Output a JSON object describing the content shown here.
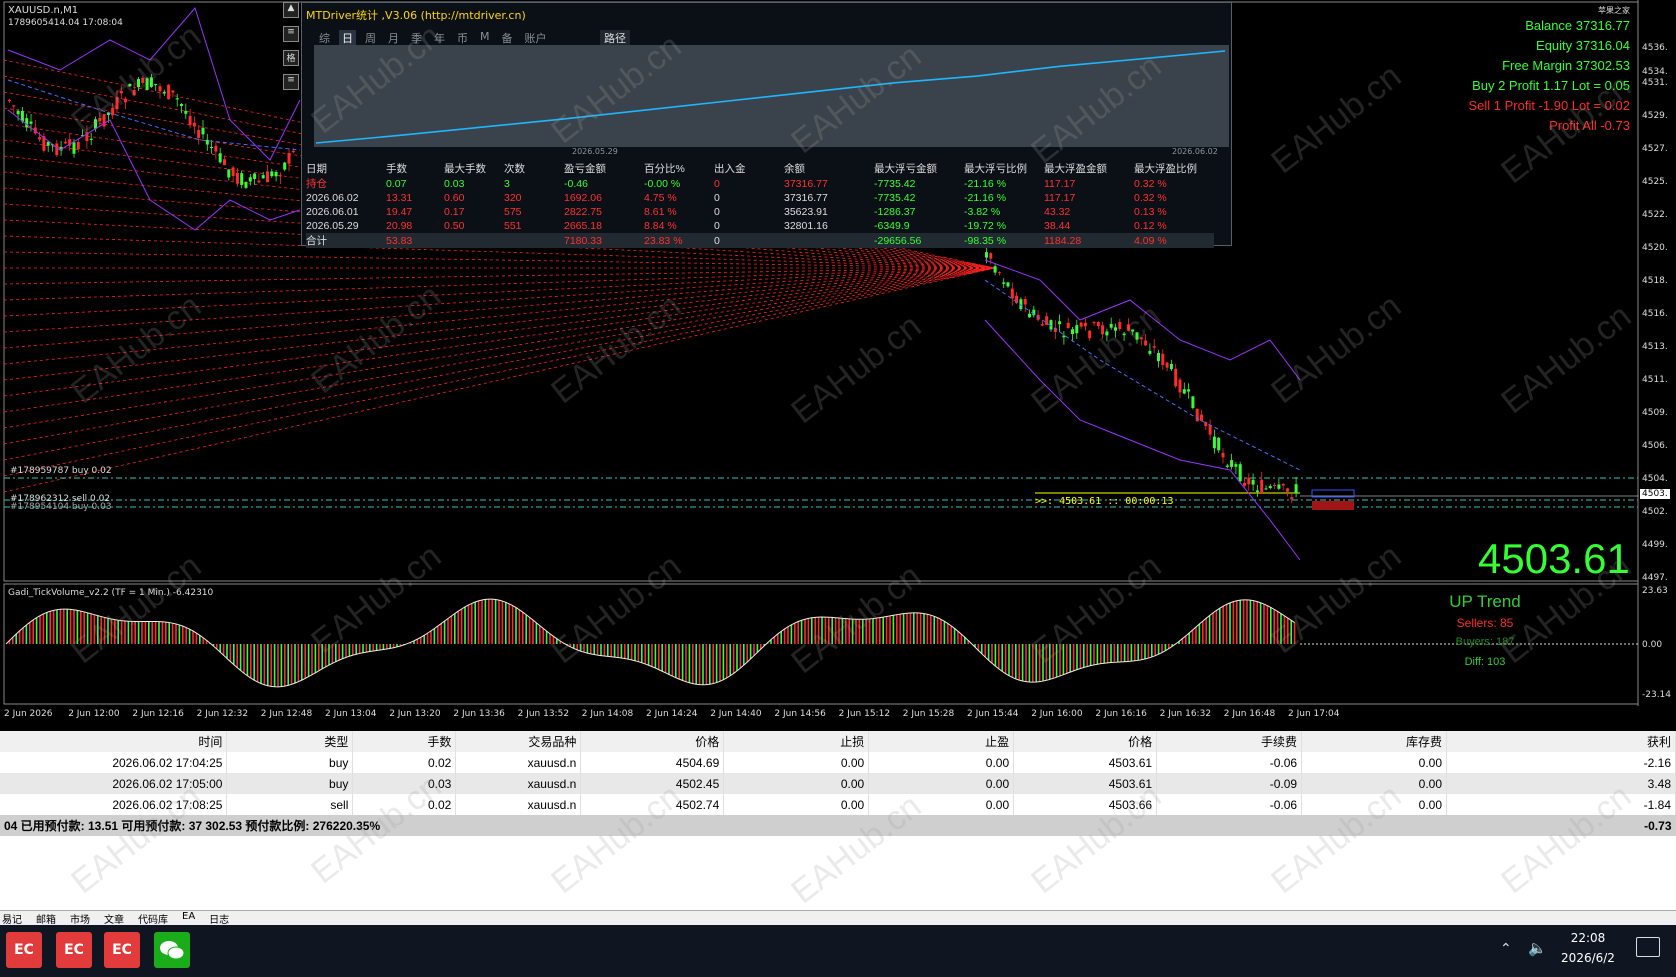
{
  "chart": {
    "symbol": "XAUUSD.n,M1",
    "sub_info": "1789605414.04     17:08:04",
    "big_price": "4503.61",
    "hud": ">>: 4503.61 :: 00:00:13",
    "corner_label": "苹果之家",
    "account": {
      "balance": "Balance 37316.77",
      "equity": "Equity 37316.04",
      "free_margin": "Free Margin 37302.53",
      "buy": "Buy 2    Profit 1.17   Lot = 0.05",
      "sell": "Sell 1    Profit -1.90   Lot = 0.02",
      "profit_all": "Profit All -0.73"
    },
    "trade_labels": [
      "#178959787 buy 0.02",
      "#178962312 sell 0.02",
      "#178954104 buy 0.03"
    ],
    "price_ticks": [
      "4536.",
      "4534.",
      "4531.",
      "4529.",
      "4527.",
      "4525.",
      "4522.",
      "4520.",
      "4518.",
      "4516.",
      "4513.",
      "4511.",
      "4509.",
      "4506.",
      "4504.",
      "4503.",
      "4502.",
      "4499.",
      "4497."
    ],
    "time_ticks": [
      "2 Jun 2026",
      "2 Jun 12:00",
      "2 Jun 12:16",
      "2 Jun 12:32",
      "2 Jun 12:48",
      "2 Jun 13:04",
      "2 Jun 13:20",
      "2 Jun 13:36",
      "2 Jun 13:52",
      "2 Jun 14:08",
      "2 Jun 14:24",
      "2 Jun 14:40",
      "2 Jun 14:56",
      "2 Jun 15:12",
      "2 Jun 15:28",
      "2 Jun 15:44",
      "2 Jun 16:00",
      "2 Jun 16:16",
      "2 Jun 16:32",
      "2 Jun 16:48",
      "2 Jun 17:04"
    ],
    "left_buttons": [
      "▲",
      "≡",
      "格",
      "≡"
    ],
    "colors": {
      "bull": "#33ff33",
      "bear": "#ff2a2a",
      "bands": "#9b30ff",
      "fan": "#ff2020",
      "equity_line": "#1fb6ff"
    }
  },
  "indicator": {
    "title": "Gadi_TickVolume_v2.2 (TF = 1 Min.) -6.42310",
    "trend": "UP Trend",
    "sellers": "Sellers: 85",
    "buyers": "Buyers: 187",
    "diff": "Diff: 103",
    "scale_top": "23.63",
    "scale_zero": "0.00",
    "scale_bottom": "-23.14"
  },
  "panel": {
    "title": "MTDriver统计 ,V3.06 (http://mtdriver.cn)",
    "tabs": [
      "综",
      "日",
      "周",
      "月",
      "季",
      "年",
      "币",
      "M",
      "备",
      "账户"
    ],
    "active_tab": "日",
    "route_tab": "路径",
    "date_start": "2026.05.29",
    "date_end": "2026.06.02",
    "headers": [
      "日期",
      "手数",
      "最大手数",
      "次数",
      "盈亏金额",
      "百分比%",
      "出入金",
      "余额",
      "最大浮亏金额",
      "最大浮亏比例",
      "最大浮盈金额",
      "最大浮盈比例"
    ],
    "rows": [
      [
        "持仓",
        "0.07",
        "0.03",
        "3",
        "-0.46",
        "-0.00 %",
        "0",
        "37316.77",
        "-7735.42",
        "-21.16 %",
        "117.17",
        "0.32 %"
      ],
      [
        "2026.06.02",
        "13.31",
        "0.60",
        "320",
        "1692.06",
        "4.75 %",
        "0",
        "37316.77",
        "-7735.42",
        "-21.16 %",
        "117.17",
        "0.32 %"
      ],
      [
        "2026.06.01",
        "19.47",
        "0.17",
        "575",
        "2822.75",
        "8.61 %",
        "0",
        "35623.91",
        "-1286.37",
        "-3.82 %",
        "43.32",
        "0.13 %"
      ],
      [
        "2026.05.29",
        "20.98",
        "0.50",
        "551",
        "2665.18",
        "8.84 %",
        "0",
        "32801.16",
        "-6349.9",
        "-19.72 %",
        "38.44",
        "0.12 %"
      ],
      [
        "合计",
        "53.83",
        "",
        "",
        "7180.33",
        "23.83 %",
        "0",
        "",
        "-29656.56",
        "-98.35 %",
        "1184.28",
        "4.09 %"
      ]
    ],
    "equity_curve": [
      31200,
      31700,
      32250,
      32800,
      33400,
      34000,
      34600,
      35200,
      35650,
      36300,
      36800,
      37316
    ]
  },
  "terminal": {
    "headers": [
      "时间",
      "类型",
      "手数",
      "交易品种",
      "价格",
      "止损",
      "止盈",
      "价格",
      "手续费",
      "库存费",
      "获利"
    ],
    "rows": [
      [
        "2026.06.02 17:04:25",
        "buy",
        "0.02",
        "xauusd.n",
        "4504.69",
        "0.00",
        "0.00",
        "4503.61",
        "-0.06",
        "0.00",
        "-2.16"
      ],
      [
        "2026.06.02 17:05:00",
        "buy",
        "0.03",
        "xauusd.n",
        "4502.45",
        "0.00",
        "0.00",
        "4503.61",
        "-0.09",
        "0.00",
        "3.48"
      ],
      [
        "2026.06.02 17:08:25",
        "sell",
        "0.02",
        "xauusd.n",
        "4502.74",
        "0.00",
        "0.00",
        "4503.66",
        "-0.06",
        "0.00",
        "-1.84"
      ]
    ],
    "footer": "04   已用预付款: 13.51   可用预付款: 37 302.53   预付款比例: 276220.35%",
    "footer_total": "-0.73",
    "bottom_tabs": [
      "易记",
      "邮箱",
      "市场",
      "文章",
      "代码库",
      "EA",
      "日志"
    ]
  },
  "taskbar": {
    "apps": [
      "EC",
      "EC",
      "EC",
      "WeChat"
    ],
    "time": "22:08",
    "date": "2026/6/2",
    "tray": [
      "chevron-up-icon",
      "speaker-icon",
      "notification-icon"
    ]
  },
  "watermark": "EAHub.cn"
}
